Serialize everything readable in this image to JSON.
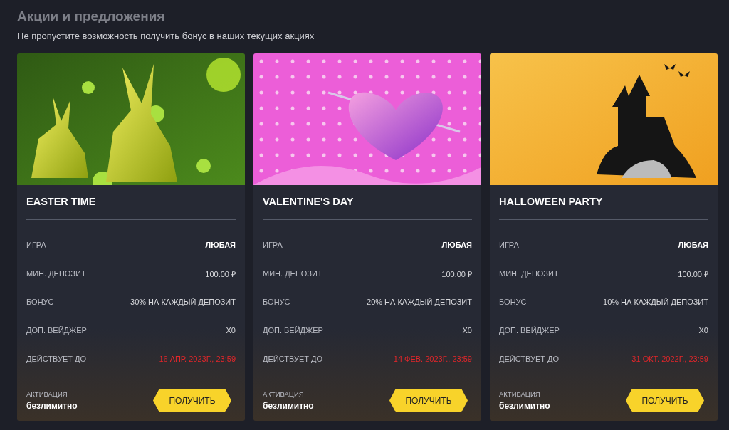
{
  "page": {
    "title": "Акции и предложения",
    "subtitle": "Не пропустите возможность получить бонус в наших текущих акциях"
  },
  "promos": [
    {
      "kind": "easter",
      "title": "EASTER TIME",
      "rows": [
        {
          "label": "ИГРА",
          "value": "ЛЮБАЯ",
          "kind": "bold"
        },
        {
          "label": "МИН. ДЕПОЗИТ",
          "value": "100.00 ₽",
          "kind": "plain"
        },
        {
          "label": "БОНУС",
          "value": "30% НА КАЖДЫЙ ДЕПОЗИТ",
          "kind": "plain"
        },
        {
          "label": "ДОП. ВЕЙДЖЕР",
          "value": "X0",
          "kind": "plain"
        },
        {
          "label": "ДЕЙСТВУЕТ ДО",
          "value": "16 АПР. 2023Г., 23:59",
          "kind": "deadline"
        }
      ],
      "activation_label": "АКТИВАЦИЯ",
      "activation_value": "безлимитно",
      "button": "ПОЛУЧИТЬ"
    },
    {
      "kind": "valentine",
      "title": "VALENTINE'S DAY",
      "rows": [
        {
          "label": "ИГРА",
          "value": "ЛЮБАЯ",
          "kind": "bold"
        },
        {
          "label": "МИН. ДЕПОЗИТ",
          "value": "100.00 ₽",
          "kind": "plain"
        },
        {
          "label": "БОНУС",
          "value": "20% НА КАЖДЫЙ ДЕПОЗИТ",
          "kind": "plain"
        },
        {
          "label": "ДОП. ВЕЙДЖЕР",
          "value": "X0",
          "kind": "plain"
        },
        {
          "label": "ДЕЙСТВУЕТ ДО",
          "value": "14 ФЕВ. 2023Г., 23:59",
          "kind": "deadline"
        }
      ],
      "activation_label": "АКТИВАЦИЯ",
      "activation_value": "безлимитно",
      "button": "ПОЛУЧИТЬ"
    },
    {
      "kind": "halloween",
      "title": "HALLOWEEN PARTY",
      "rows": [
        {
          "label": "ИГРА",
          "value": "ЛЮБАЯ",
          "kind": "bold"
        },
        {
          "label": "МИН. ДЕПОЗИТ",
          "value": "100.00 ₽",
          "kind": "plain"
        },
        {
          "label": "БОНУС",
          "value": "10% НА КАЖДЫЙ ДЕПОЗИТ",
          "kind": "plain"
        },
        {
          "label": "ДОП. ВЕЙДЖЕР",
          "value": "X0",
          "kind": "plain"
        },
        {
          "label": "ДЕЙСТВУЕТ ДО",
          "value": "31 ОКТ. 2022Г., 23:59",
          "kind": "deadline"
        }
      ],
      "activation_label": "АКТИВАЦИЯ",
      "activation_value": "безлимитно",
      "button": "ПОЛУЧИТЬ"
    }
  ]
}
